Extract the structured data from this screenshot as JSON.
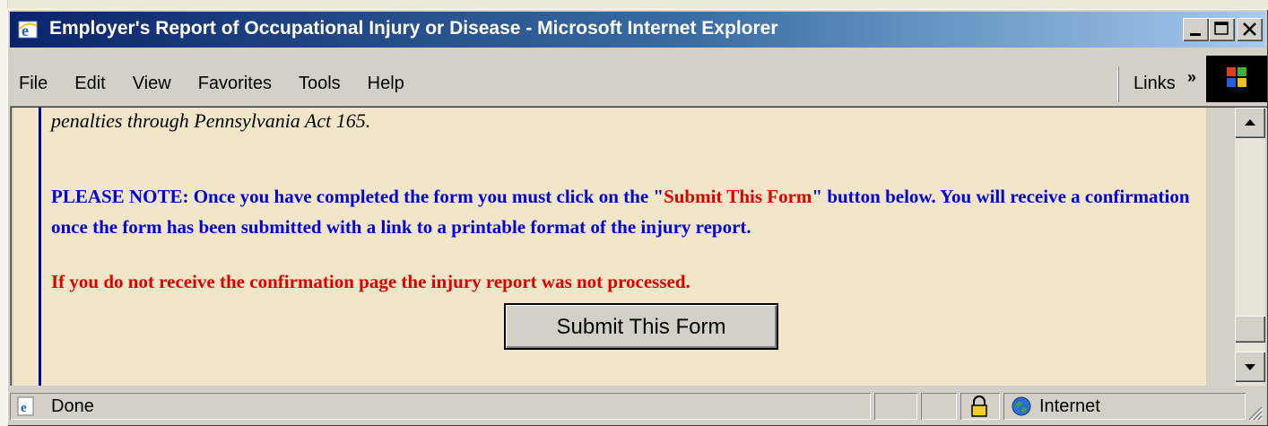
{
  "window": {
    "title": "Employer's Report of Occupational Injury or Disease - Microsoft Internet Explorer",
    "icon": "ie-logo-icon"
  },
  "menu": {
    "items": [
      {
        "label": "File"
      },
      {
        "label": "Edit"
      },
      {
        "label": "View"
      },
      {
        "label": "Favorites"
      },
      {
        "label": "Tools"
      },
      {
        "label": "Help"
      }
    ],
    "links_label": "Links",
    "links_chevron": "»"
  },
  "content": {
    "italic_line": "penalties through Pennsylvania Act 165.",
    "note_part1": "PLEASE NOTE: Once you have completed the form you must click on the \"",
    "note_highlight": "Submit This Form",
    "note_part2": "\" button below. You will receive a confirmation once the form has been submitted with a link to a printable format of the injury report.",
    "warning": "If you do not receive the confirmation page the injury report was not processed.",
    "submit_button": "Submit This Form"
  },
  "status": {
    "text": "Done",
    "zone": "Internet"
  },
  "colors": {
    "page_bg": "#f1e6c8",
    "note_blue": "#0000e0",
    "warning_red": "#e00000"
  }
}
